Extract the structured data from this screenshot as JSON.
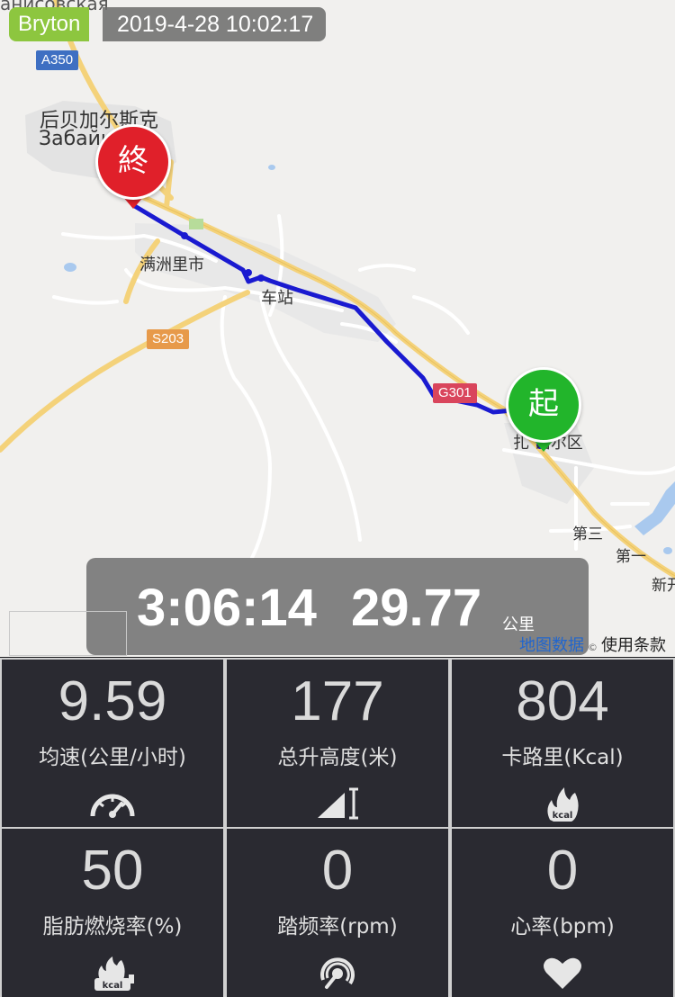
{
  "header": {
    "brand": "Bryton",
    "datetime": "2019-4-28 10:02:17"
  },
  "map": {
    "top_label_partial": "анисовская",
    "city_name_cn": "后贝加尔斯克",
    "city_name_ru": "Забайка  к",
    "manzhouli": "满洲里市",
    "station": "车站",
    "district": "扎  诺尔区",
    "label_di_san": "第三",
    "label_di_yi": "第一",
    "label_xin": "新开",
    "shields": {
      "a350": "A350",
      "s203": "S203",
      "g301": "G301"
    },
    "marker_end": "終",
    "marker_start": "起",
    "attribution_data": "地图数据",
    "attribution_sep": "©",
    "attribution_terms": "使用条款",
    "colors": {
      "route": "#1a1ad0",
      "road": "#f4d27a",
      "end_marker": "#e0202a",
      "start_marker": "#22b52b"
    }
  },
  "summary": {
    "duration": "3:06:14",
    "distance": "29.77",
    "distance_unit": "公里"
  },
  "stats": [
    {
      "value": "9.59",
      "label": "均速(公里/小时)",
      "icon": "speedometer-icon"
    },
    {
      "value": "177",
      "label": "总升高度(米)",
      "icon": "elevation-icon"
    },
    {
      "value": "804",
      "label": "卡路里(Kcal)",
      "icon": "kcal-flame-icon"
    },
    {
      "value": "50",
      "label": "脂肪燃烧率(%)",
      "icon": "fat-burn-icon"
    },
    {
      "value": "0",
      "label": "踏频率(rpm)",
      "icon": "cadence-icon"
    },
    {
      "value": "0",
      "label": "心率(bpm)",
      "icon": "heart-icon"
    }
  ]
}
